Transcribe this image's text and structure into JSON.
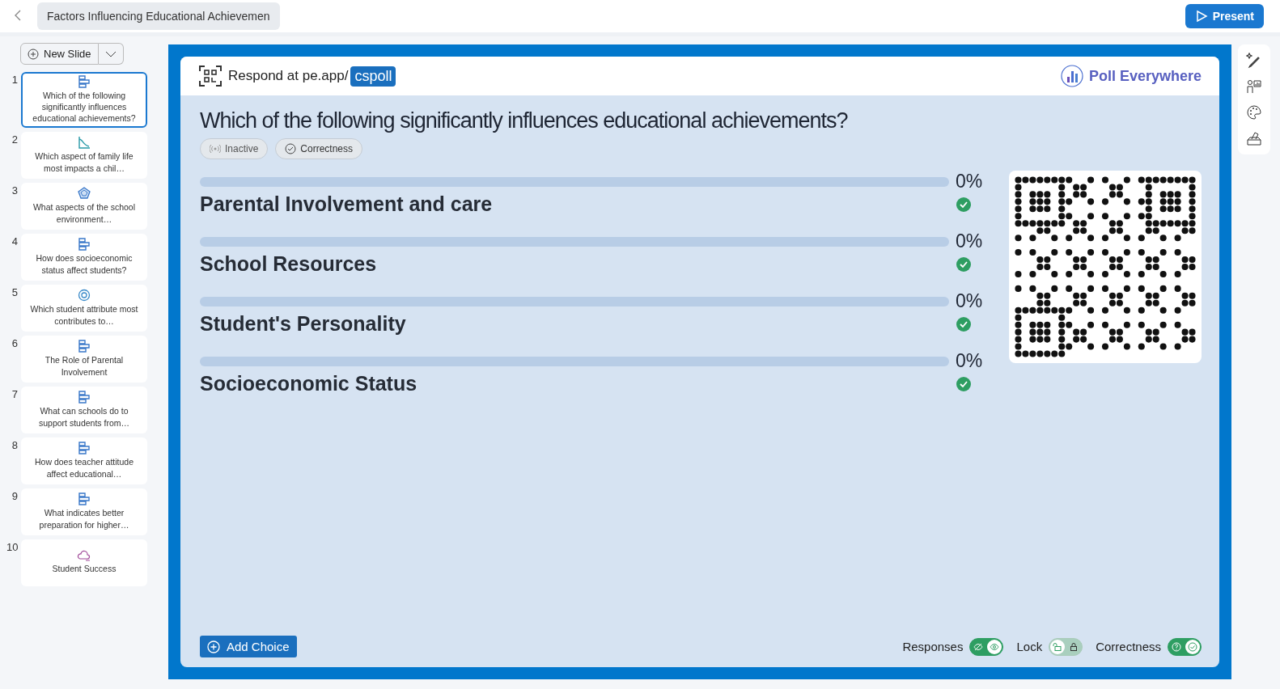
{
  "top_bar": {
    "title": "Factors Influencing Educational Achievemen",
    "present_label": "Present"
  },
  "new_slide": {
    "label": "New Slide"
  },
  "slides": [
    {
      "number": "1",
      "kind": "bar",
      "title": "Which of the following significantly influences educational achievements?",
      "selected": true
    },
    {
      "number": "2",
      "kind": "line",
      "title": "Which aspect of family life most impacts a chil…",
      "selected": false
    },
    {
      "number": "3",
      "kind": "radar",
      "title": "What aspects of the school environment…",
      "selected": false
    },
    {
      "number": "4",
      "kind": "bar",
      "title": "How does socioeconomic status affect students?",
      "selected": false
    },
    {
      "number": "5",
      "kind": "target",
      "title": "Which student attribute most contributes to…",
      "selected": false
    },
    {
      "number": "6",
      "kind": "bar",
      "title": "The Role of Parental Involvement",
      "selected": false
    },
    {
      "number": "7",
      "kind": "bar",
      "title": "What can schools do to support students from…",
      "selected": false
    },
    {
      "number": "8",
      "kind": "bar",
      "title": "How does teacher attitude affect educational…",
      "selected": false
    },
    {
      "number": "9",
      "kind": "bar",
      "title": "What indicates better preparation for higher…",
      "selected": false
    },
    {
      "number": "10",
      "kind": "cloud",
      "title": "Student Success",
      "selected": false
    }
  ],
  "slide": {
    "respond_text": "Respond at pe.app/",
    "code": "cspoll",
    "brand": "Poll Everywhere",
    "question": "Which of the following significantly influences educational achievements?",
    "tags": [
      {
        "kind": "status",
        "label": "Inactive"
      },
      {
        "kind": "correctness",
        "label": "Correctness"
      }
    ],
    "choices": [
      {
        "label": "Parental Involvement and care",
        "percent": "0%",
        "level": 0,
        "correct": true
      },
      {
        "label": "School Resources",
        "percent": "0%",
        "level": 0,
        "correct": true
      },
      {
        "label": "Student's Personality",
        "percent": "0%",
        "level": 0,
        "correct": true
      },
      {
        "label": "Socioeconomic Status",
        "percent": "0%",
        "level": 0,
        "correct": true
      }
    ],
    "add_choice": "Add Choice",
    "toggles": [
      {
        "kind": "responses",
        "label": "Responses",
        "on": true
      },
      {
        "kind": "lock",
        "label": "Lock",
        "on": false
      },
      {
        "kind": "correctness",
        "label": "Correctness",
        "on": true
      }
    ]
  }
}
